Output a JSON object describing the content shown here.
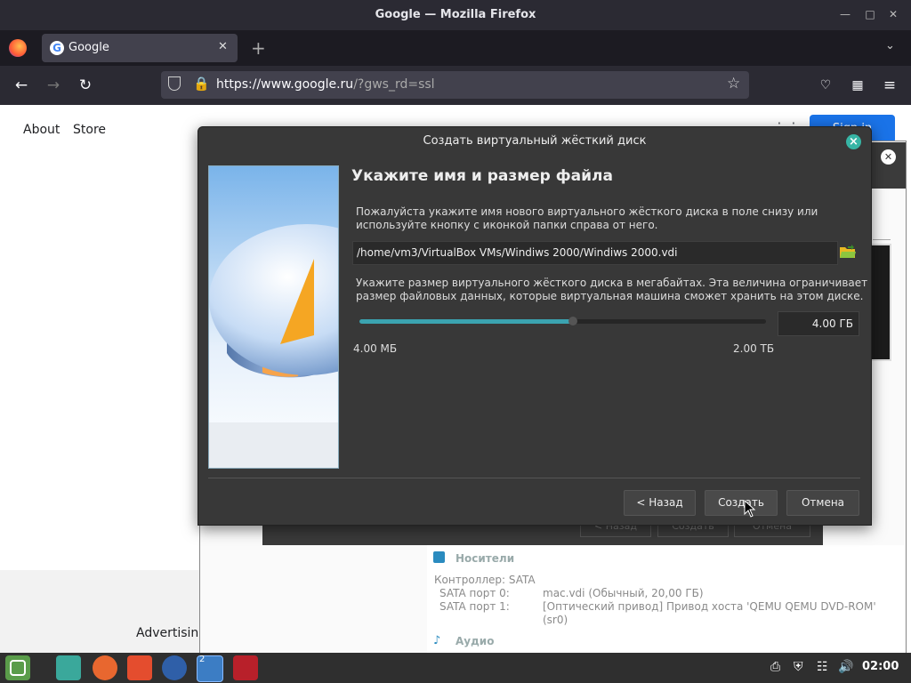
{
  "browser": {
    "window_title": "Google — Mozilla Firefox",
    "tab_title": "Google",
    "url_host": "https://www.google.ru",
    "url_rest": "/?gws_rd=ssl",
    "new_tab_symbol": "+"
  },
  "google_page": {
    "links": [
      "About",
      "Store"
    ],
    "signin_label": "Sign in",
    "advertising_label": "Advertising"
  },
  "background_vbox": {
    "storage_header": "Носители",
    "audio_header": "Аудио",
    "controller": "Контроллер: SATA",
    "rows": [
      {
        "label": "SATA порт 0:",
        "value": "mac.vdi (Обычный, 20,00 ГБ)"
      },
      {
        "label": "SATA порт 1:",
        "value": "[Оптический привод] Привод хоста 'QEMU QEMU DVD-ROM' (sr0)"
      }
    ],
    "ghost_buttons": [
      "< Назад",
      "Создать",
      "Отмена"
    ]
  },
  "dialog": {
    "title": "Создать виртуальный жёсткий диск",
    "heading": "Укажите имя и размер файла",
    "desc1_line1": "Пожалуйста укажите имя нового виртуального жёсткого диска в поле снизу или",
    "desc1_line2": "используйте кнопку с иконкой папки справа от него.",
    "path_value": "/home/vm3/VirtualBox VMs/Windiws 2000/Windiws 2000.vdi",
    "desc2_line1": "Укажите размер виртуального жёсткого диска в мегабайтах. Эта величина ограничивает",
    "desc2_line2": "размер файловых данных, которые виртуальная машина сможет хранить на этом диске.",
    "size_value": "4.00 ГБ",
    "slider_fraction": 0.52,
    "min_label": "4.00 МБ",
    "max_label": "2.00 ТБ",
    "back_label": "< Назад",
    "create_label": "Создать",
    "cancel_label": "Отмена"
  },
  "taskbar": {
    "clock": "02:00",
    "workspace_badge": "2"
  },
  "colors": {
    "accent": "#3ba3b0",
    "close_button": "#37b5a5",
    "signin_blue": "#1a73e8"
  }
}
